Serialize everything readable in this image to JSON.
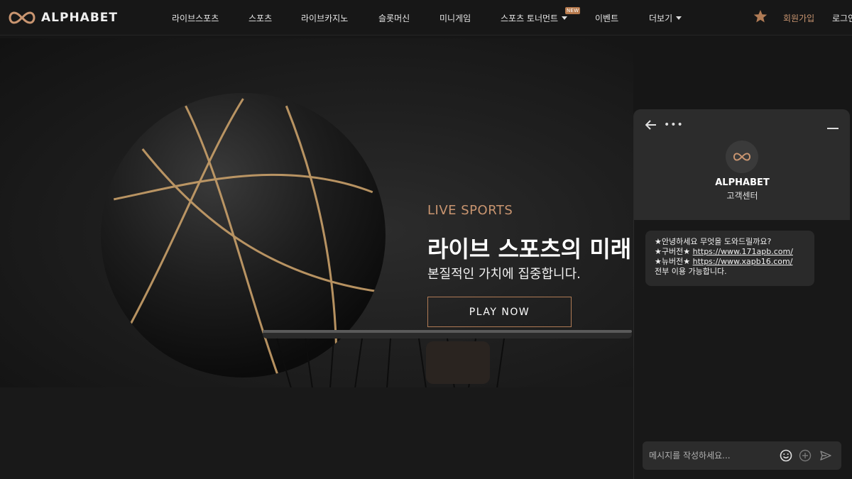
{
  "brand": {
    "name": "ALPHABET",
    "accent": "#c99570"
  },
  "nav": {
    "items": [
      {
        "label": "라이브스포츠"
      },
      {
        "label": "스포츠"
      },
      {
        "label": "라이브카지노"
      },
      {
        "label": "슬롯머신"
      },
      {
        "label": "미니게임"
      },
      {
        "label": "스포츠 토너먼트"
      },
      {
        "label": "이벤트"
      },
      {
        "label": "더보기"
      }
    ],
    "new_badge": "NEW",
    "join_label": "회원가입",
    "login_label": "로그인"
  },
  "hero": {
    "kicker": "LIVE SPORTS",
    "title": "라이브 스포츠의 미래",
    "subtitle": "본질적인 가치에 집중합니다.",
    "cta": "PLAY NOW"
  },
  "chat": {
    "brand": "ALPHABET",
    "dept": "고객센터",
    "more": "•••",
    "message": {
      "line1": "★안녕하세요 무엇을 도와드릴까요?",
      "line2_prefix": "★구버전★ ",
      "line2_link": "https://www.171apb.com/",
      "line3_prefix": "★뉴버전★ ",
      "line3_link": "https://www.xapb16.com/",
      "line4": "전부 이용 가능합니다."
    },
    "placeholder": "메시지를 작성하세요..."
  }
}
